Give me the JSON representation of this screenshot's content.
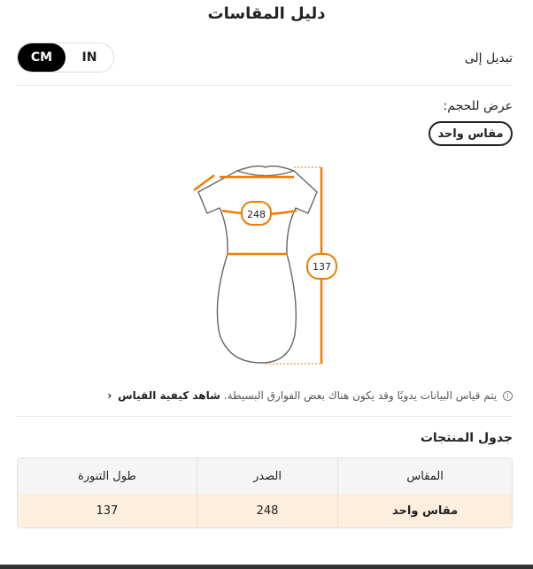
{
  "title": "دليل المقاسات",
  "switch": {
    "label": "تبديل إلى",
    "options": [
      "IN",
      "CM"
    ],
    "selected": "CM"
  },
  "view": {
    "label": "عرض للحجم:",
    "chip": "مقاس واحد"
  },
  "diagram": {
    "chest_value": "248",
    "length_value": "137",
    "measure_color": "#f07c00"
  },
  "note": {
    "text": "يتم قياس البيانات يدويًا وقد يكون هناك بعض الفوارق البسيطة.",
    "link": "شاهد كيفية القياس",
    "icon": "info-icon",
    "chevron": "‹"
  },
  "table": {
    "heading": "جدول المنتجات",
    "headers": [
      "المقاس",
      "الصدر",
      "طول التنورة"
    ],
    "rows": [
      [
        "مقاس واحد",
        "248",
        "137"
      ]
    ],
    "highlight_color": "#fdeedd"
  }
}
